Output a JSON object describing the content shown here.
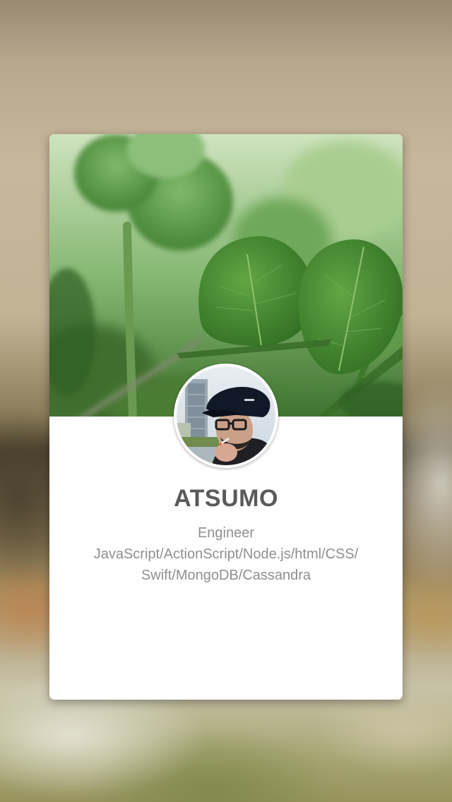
{
  "profile": {
    "name": "ATSUMO",
    "bio_lines": [
      "Engineer",
      "JavaScript/ActionScript/Node.js/html/CSS/",
      "Swift/MongoDB/Cassandra"
    ]
  },
  "colors": {
    "card_background": "#ffffff",
    "name_text": "#5a5a5a",
    "bio_text": "#8f8f8f"
  }
}
